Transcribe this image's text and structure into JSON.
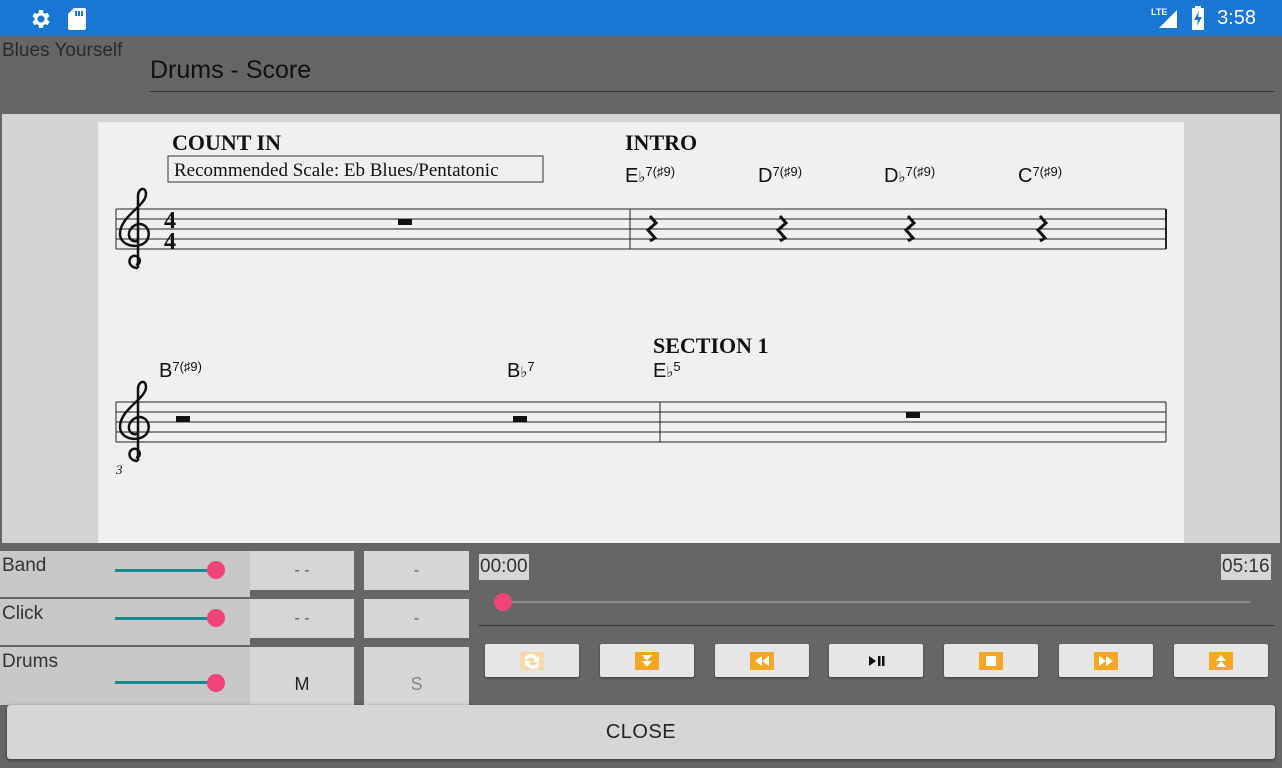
{
  "status_bar": {
    "time": "3:58",
    "network": "LTE",
    "icons": [
      "settings-gear-icon",
      "sd-card-icon",
      "lte-signal-icon",
      "battery-charging-icon"
    ],
    "color": "#1976d2"
  },
  "header": {
    "app_name": "Blues Yourself",
    "score_title": "Drums - Score"
  },
  "score": {
    "count_in": "COUNT IN",
    "recommended_scale": "Recommended Scale: Eb Blues/Pentatonic",
    "intro": "INTRO",
    "section_1": "SECTION 1",
    "time_signature_top": "4",
    "time_signature_bottom": "4",
    "measure_number": "3",
    "system1_chords": [
      {
        "root": "E",
        "accidental": "♭",
        "ext": "7(♯9)"
      },
      {
        "root": "D",
        "accidental": "",
        "ext": "7(♯9)"
      },
      {
        "root": "D",
        "accidental": "♭",
        "ext": "7(♯9)"
      },
      {
        "root": "C",
        "accidental": "",
        "ext": "7(♯9)"
      }
    ],
    "system2_chords": [
      {
        "root": "B",
        "accidental": "",
        "ext": "7(♯9)"
      },
      {
        "root": "B",
        "accidental": "♭",
        "ext": "7"
      },
      {
        "root": "E",
        "accidental": "♭",
        "ext": "5"
      }
    ]
  },
  "mixer": {
    "tracks": [
      {
        "label": "Band",
        "volume": 1.0,
        "mute_label": "- -",
        "solo_label": "-"
      },
      {
        "label": "Click",
        "volume": 1.0,
        "mute_label": "- -",
        "solo_label": "-"
      },
      {
        "label": "Drums",
        "volume": 1.0,
        "mute_label": "M",
        "solo_label": "S"
      }
    ]
  },
  "transport": {
    "current_time": "00:00",
    "total_time": "05:16",
    "position": 0.0,
    "buttons": [
      "loop-icon",
      "skip-down-icon",
      "rewind-icon",
      "play-pause-icon",
      "stop-icon",
      "fast-forward-icon",
      "skip-up-icon"
    ],
    "accent_color": "#f5a623"
  },
  "close_label": "CLOSE"
}
